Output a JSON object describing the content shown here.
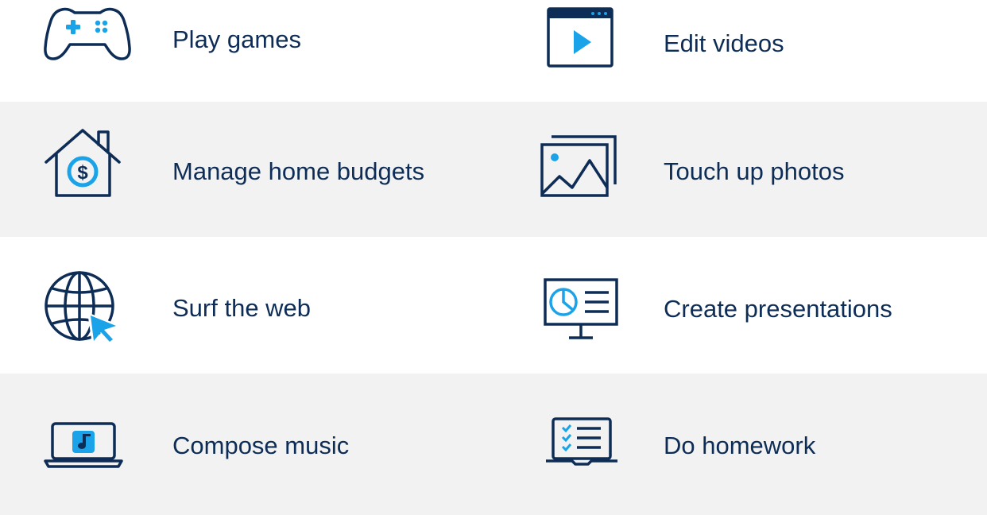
{
  "colors": {
    "text": "#0e2d56",
    "icon_primary": "#0e2d56",
    "icon_accent": "#1aa3e8",
    "row_shade": "#f2f2f2",
    "background": "#ffffff"
  },
  "activities": [
    {
      "label": "Play games",
      "icon": "gamepad-icon"
    },
    {
      "label": "Edit videos",
      "icon": "video-player-icon"
    },
    {
      "label": "Manage home budgets",
      "icon": "home-budget-icon"
    },
    {
      "label": "Touch up photos",
      "icon": "photos-icon"
    },
    {
      "label": "Surf the web",
      "icon": "globe-cursor-icon"
    },
    {
      "label": "Create presentations",
      "icon": "presentation-monitor-icon"
    },
    {
      "label": "Compose music",
      "icon": "laptop-music-icon"
    },
    {
      "label": "Do homework",
      "icon": "laptop-checklist-icon"
    }
  ]
}
